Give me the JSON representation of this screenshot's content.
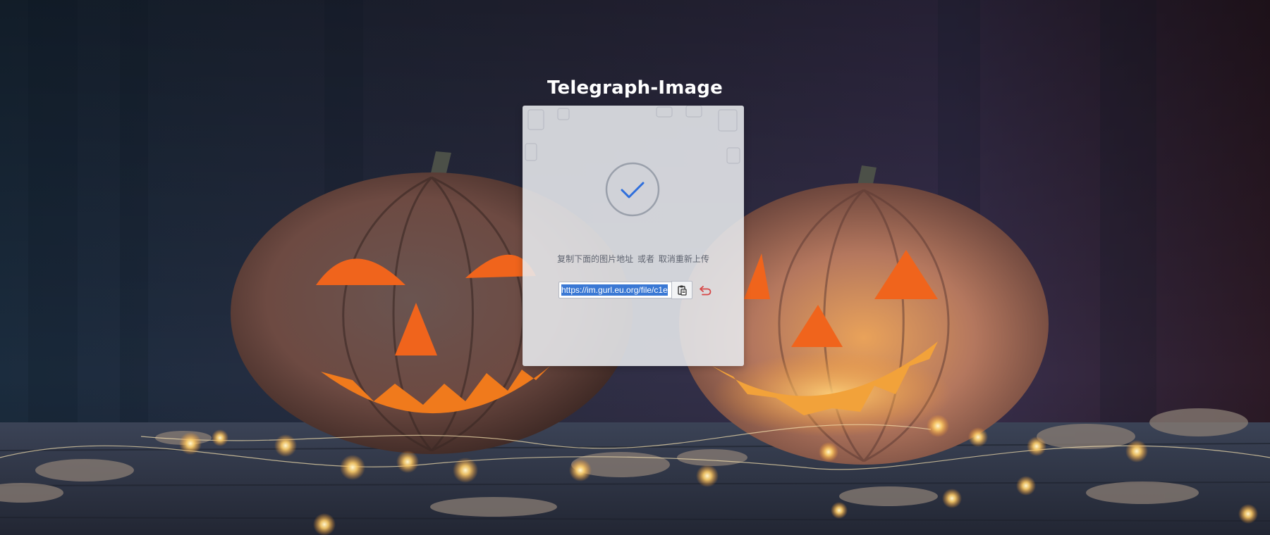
{
  "app": {
    "title": "Telegraph-Image"
  },
  "upload_result": {
    "status": "success",
    "hint_copy": "复制下面的图片地址",
    "hint_or": "或者",
    "hint_cancel": "取消重新上传",
    "url_value": "https://im.gurl.eu.org/file/c1e",
    "copy_icon": "clipboard-icon",
    "undo_icon": "undo-icon"
  },
  "colors": {
    "accent_check": "#2f6fdc",
    "undo_red": "#d64545",
    "selection": "#3a78d4"
  }
}
